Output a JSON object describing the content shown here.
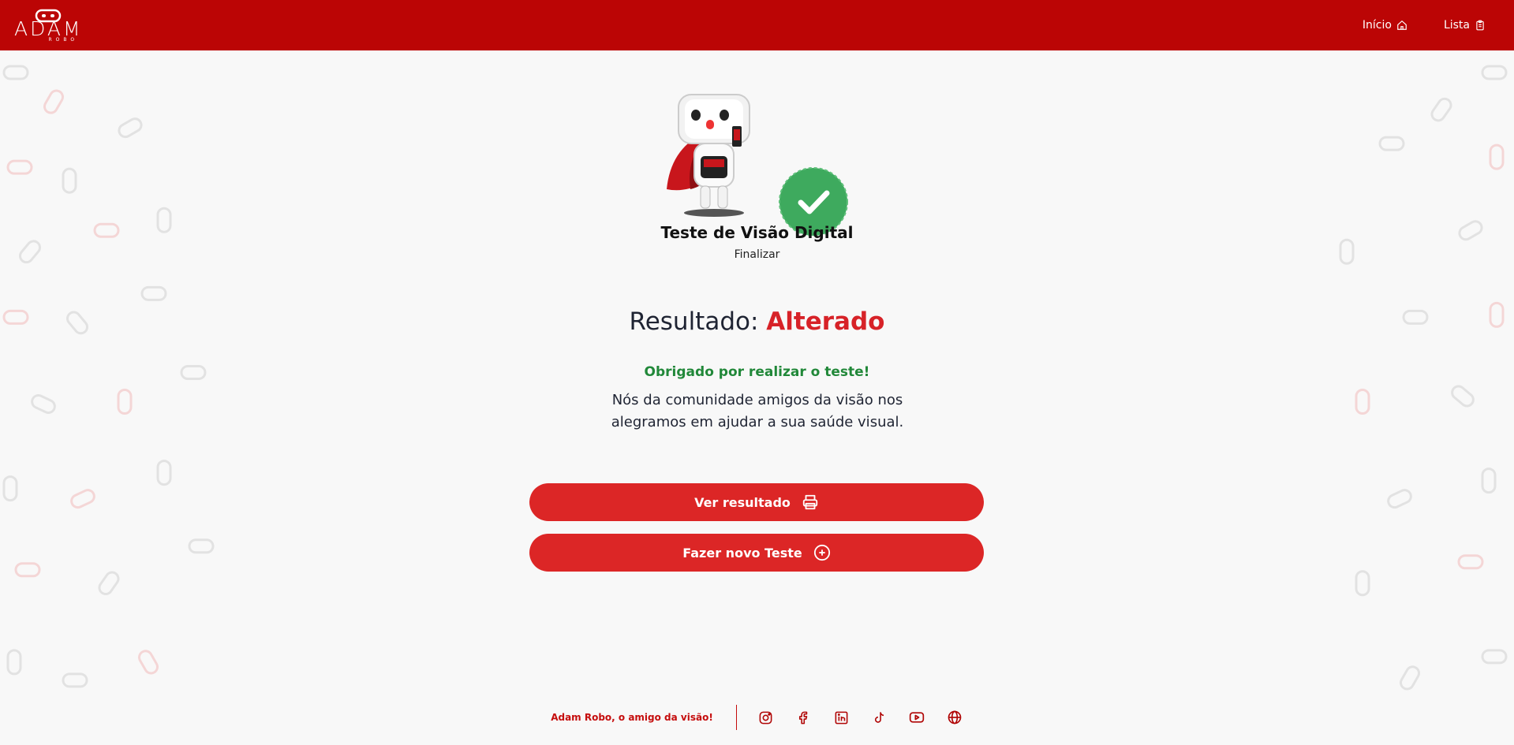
{
  "header": {
    "logo_text": "ADAM",
    "logo_sub": "ROBO",
    "nav": [
      {
        "label": "Início",
        "icon": "home-icon"
      },
      {
        "label": "Lista",
        "icon": "clipboard-icon"
      }
    ]
  },
  "main": {
    "test_title": "Teste de Visão Digital",
    "test_step": "Finalizar",
    "result_label": "Resultado:",
    "result_value": "Alterado",
    "thanks": "Obrigado por realizar o teste!",
    "message": "Nós da comunidade amigos da visão nos alegramos em ajudar a sua saúde visual.",
    "buttons": [
      {
        "label": "Ver resultado",
        "icon": "printer-icon"
      },
      {
        "label": "Fazer novo Teste",
        "icon": "plus-circle-icon"
      }
    ]
  },
  "footer": {
    "tagline": "Adam Robo, o amigo da visão!",
    "socials": [
      "instagram-icon",
      "facebook-icon",
      "linkedin-icon",
      "tiktok-icon",
      "youtube-icon",
      "globe-icon"
    ]
  },
  "colors": {
    "header_bg": "#bb0505",
    "button_bg": "#dc2626",
    "result_red": "#d72228",
    "thanks_green": "#218839",
    "badge_green": "#3eaa5e"
  }
}
